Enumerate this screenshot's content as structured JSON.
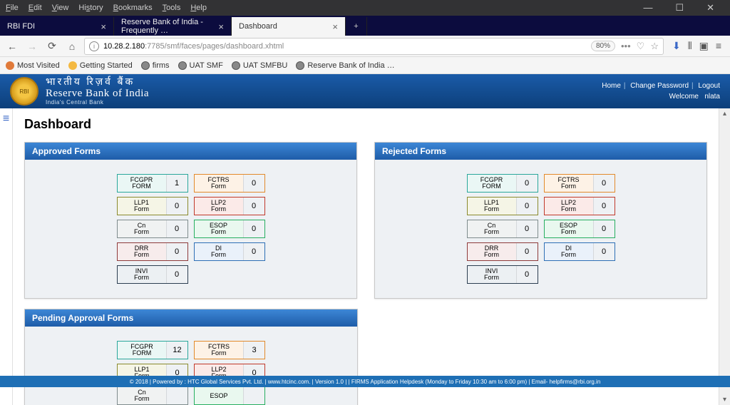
{
  "menu": {
    "file": "File",
    "edit": "Edit",
    "view": "View",
    "history": "History",
    "bookmarks": "Bookmarks",
    "tools": "Tools",
    "help": "Help"
  },
  "window": {
    "min": "—",
    "max": "☐",
    "close": "✕"
  },
  "tabs": [
    {
      "label": "RBI FDI"
    },
    {
      "label": "Reserve Bank of India - Frequently …"
    },
    {
      "label": "Dashboard"
    }
  ],
  "address": {
    "url_host": "10.28.2.180",
    "url_path": ":7785/smf/faces/pages/dashboard.xhtml",
    "zoom": "80%"
  },
  "bookmarks": [
    {
      "label": "Most Visited"
    },
    {
      "label": "Getting Started"
    },
    {
      "label": "firms"
    },
    {
      "label": "UAT SMF"
    },
    {
      "label": "UAT SMFBU"
    },
    {
      "label": "Reserve Bank of India …"
    }
  ],
  "header": {
    "hindi": "भारतीय  रिज़र्व  बैंक",
    "eng": "Reserve Bank of India",
    "sub": "India's Central Bank",
    "links": {
      "home": "Home",
      "changepw": "Change Password",
      "logout": "Logout"
    },
    "welcome_label": "Welcome",
    "welcome_user": "nlata"
  },
  "page_title": "Dashboard",
  "panels": {
    "approved": {
      "title": "Approved Forms",
      "cells": [
        {
          "label": "FCGPR FORM",
          "value": "1",
          "cls": "c-teal"
        },
        {
          "label": "FCTRS Form",
          "value": "0",
          "cls": "c-orange"
        },
        {
          "label": "LLP1 Form",
          "value": "0",
          "cls": "c-olive"
        },
        {
          "label": "LLP2 Form",
          "value": "0",
          "cls": "c-red"
        },
        {
          "label": "Cn Form",
          "value": "0",
          "cls": "c-grey"
        },
        {
          "label": "ESOP Form",
          "value": "0",
          "cls": "c-green"
        },
        {
          "label": "DRR Form",
          "value": "0",
          "cls": "c-maroon"
        },
        {
          "label": "DI Form",
          "value": "0",
          "cls": "c-blue"
        },
        {
          "label": "INVI Form",
          "value": "0",
          "cls": "c-navy"
        }
      ]
    },
    "rejected": {
      "title": "Rejected Forms",
      "cells": [
        {
          "label": "FCGPR FORM",
          "value": "0",
          "cls": "c-teal"
        },
        {
          "label": "FCTRS Form",
          "value": "0",
          "cls": "c-orange"
        },
        {
          "label": "LLP1 Form",
          "value": "0",
          "cls": "c-olive"
        },
        {
          "label": "LLP2 Form",
          "value": "0",
          "cls": "c-red"
        },
        {
          "label": "Cn Form",
          "value": "0",
          "cls": "c-grey"
        },
        {
          "label": "ESOP Form",
          "value": "0",
          "cls": "c-green"
        },
        {
          "label": "DRR Form",
          "value": "0",
          "cls": "c-maroon"
        },
        {
          "label": "DI Form",
          "value": "0",
          "cls": "c-blue"
        },
        {
          "label": "INVI Form",
          "value": "0",
          "cls": "c-navy"
        }
      ]
    },
    "pending": {
      "title": "Pending Approval Forms",
      "cells": [
        {
          "label": "FCGPR FORM",
          "value": "12",
          "cls": "c-teal"
        },
        {
          "label": "FCTRS Form",
          "value": "3",
          "cls": "c-orange"
        },
        {
          "label": "LLP1 Form",
          "value": "0",
          "cls": "c-olive"
        },
        {
          "label": "LLP2 Form",
          "value": "0",
          "cls": "c-red"
        },
        {
          "label": "Cn Form",
          "value": "",
          "cls": "c-grey"
        },
        {
          "label": "ESOP",
          "value": "",
          "cls": "c-green"
        }
      ]
    }
  },
  "footer": "© 2018 | Powered by : HTC Global Services Pvt. Ltd. | www.htcinc.com. | Version 1.0 | | FIRMS Application Helpdesk (Monday to Friday 10:30 am to 6:00 pm) | Email- helpfirms@rbi.org.in"
}
